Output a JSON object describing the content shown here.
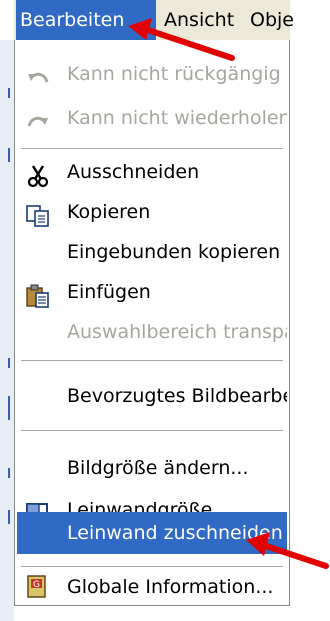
{
  "menubar": {
    "edit": "Bearbeiten",
    "view": "Ansicht",
    "object": "Obje"
  },
  "menu": {
    "undo": "Kann nicht rückgängig m",
    "redo": "Kann nicht wiederholen",
    "cut": "Ausschneiden",
    "copy": "Kopieren",
    "paste_embedded": "Eingebunden kopieren",
    "paste": "Einfügen",
    "select_transparent": "Auswahlbereich transpa",
    "preferred_editor": "Bevorzugtes Bildbearbe",
    "resize_image": "Bildgröße ändern...",
    "canvas_size": "Leinwandgröße...",
    "crop_canvas": "Leinwand zuschneiden",
    "global_info": "Globale Information..."
  },
  "colors": {
    "highlight": "#316ac5",
    "disabled_text": "#a7a69e",
    "annotation_arrow": "#e00000"
  },
  "icons": {
    "undo": "undo-arrow-icon",
    "redo": "redo-arrow-icon",
    "cut": "scissors-icon",
    "copy": "copy-documents-icon",
    "paste": "clipboard-paste-icon",
    "canvas_size": "canvas-resize-icon",
    "global_info": "info-document-icon",
    "arrow": "red-pointer-arrow"
  }
}
